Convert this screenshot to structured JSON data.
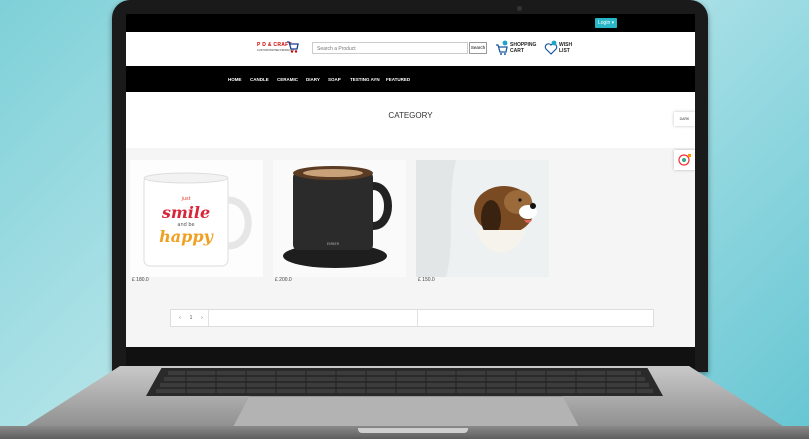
{
  "topbar": {
    "login_label": "Login ▾"
  },
  "header": {
    "logo_text": "P D & CRAFT",
    "logo_sub": "CUSTOM PRINTED PRODUCTS",
    "search_placeholder": "Search a Product",
    "search_button": "Search",
    "cart_line1": "SHOPPING",
    "cart_line2": "CART",
    "wish_line1": "WISH",
    "wish_line2": "LIST"
  },
  "nav": {
    "items": [
      "HOME",
      "CANDLE",
      "CERAMIC",
      "DIARY",
      "SOAP",
      "TESTING AYN",
      "FEATURED"
    ]
  },
  "main": {
    "title": "CATEGORY"
  },
  "side": {
    "dark_label": "DARK"
  },
  "products": [
    {
      "price": "£ 180.0",
      "mug_text1": "just",
      "mug_text2": "smile",
      "mug_text3": "and be",
      "mug_text4": "happy"
    },
    {
      "price": "£ 200.0",
      "brand": "EMBER"
    },
    {
      "price": "£ 150.0"
    }
  ],
  "pagination": {
    "prev": "‹",
    "page": "1",
    "next": "›"
  },
  "colors": {
    "accent": "#27b7c7",
    "nav_bg": "#000000",
    "logo_red": "#cc0000"
  }
}
